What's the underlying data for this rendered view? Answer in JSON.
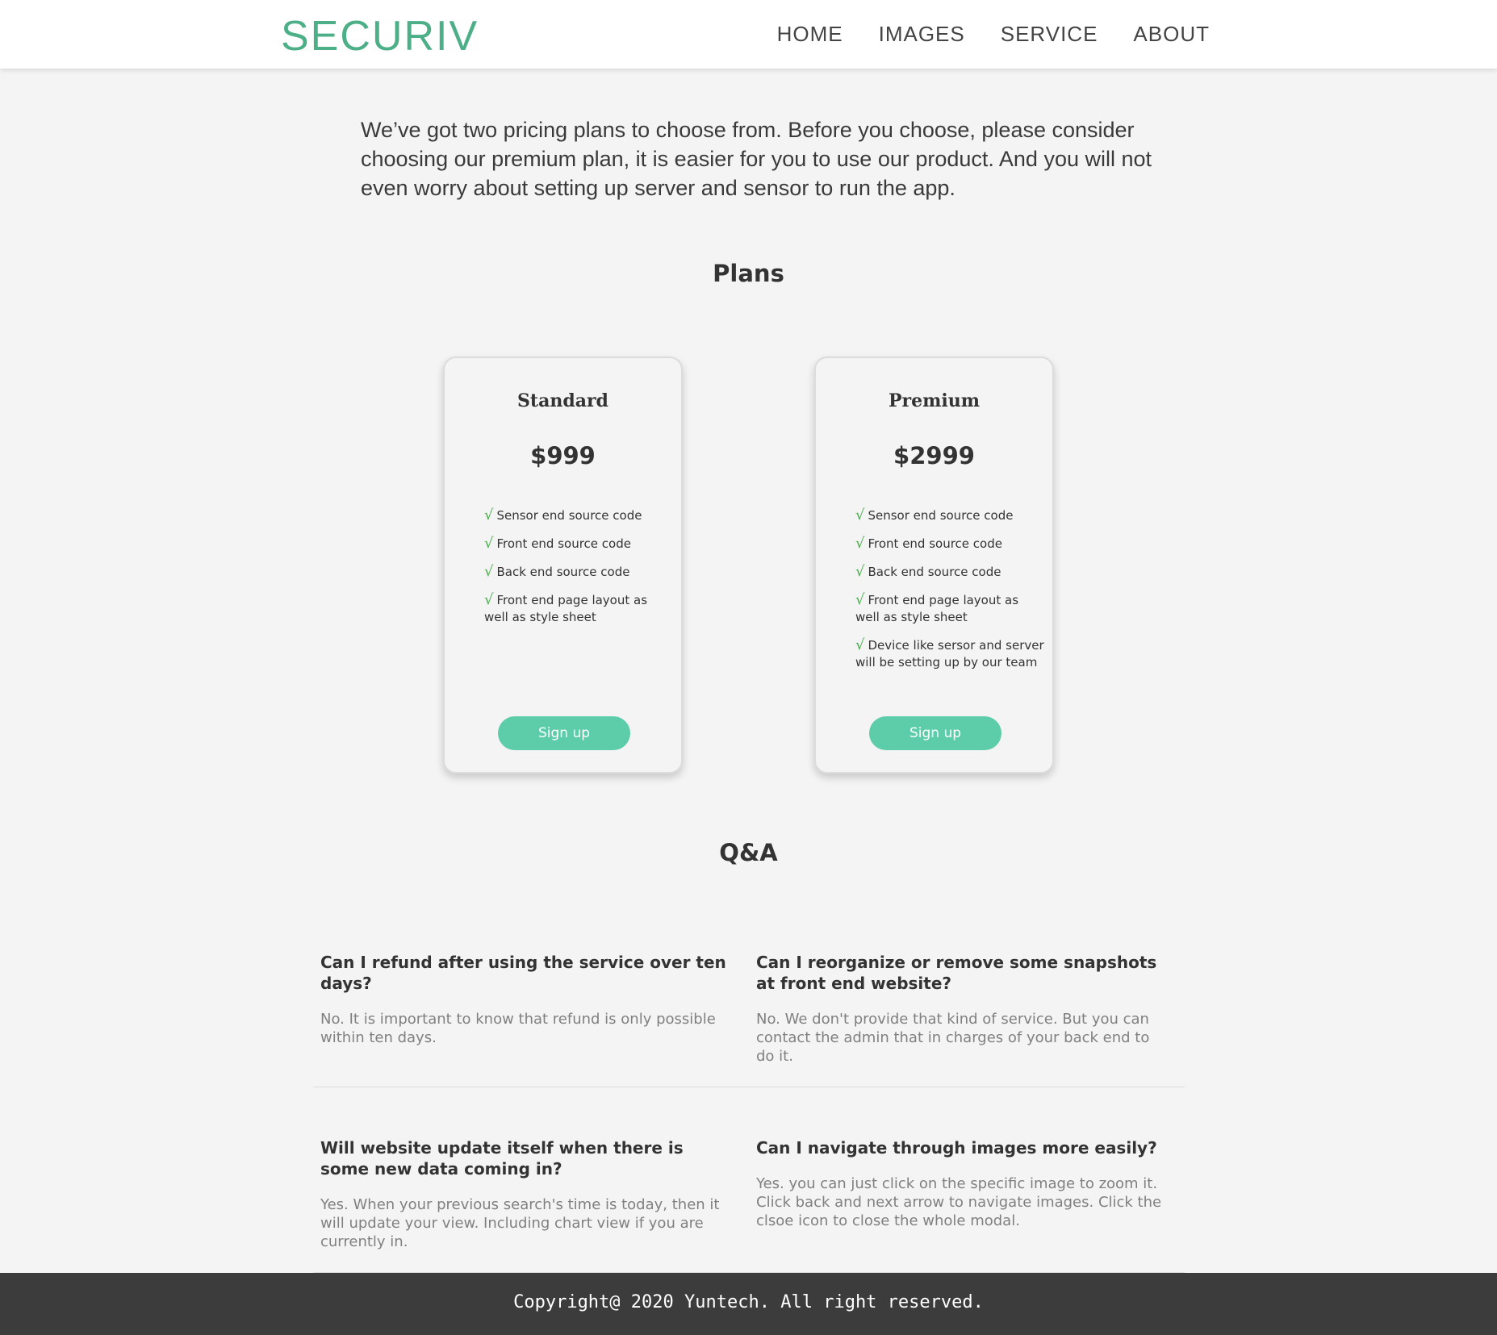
{
  "colors": {
    "brand": "#4caf88",
    "accent": "#5ccda8",
    "check": "#4caf50",
    "background": "#f4f4f4",
    "footer": "#3c3c3c"
  },
  "nav": {
    "brand": "SECURIV",
    "links": [
      "HOME",
      "IMAGES",
      "SERVICE",
      "ABOUT"
    ]
  },
  "intro": "We’ve got two pricing plans to choose from. Before you choose, please consider choosing our premium plan, it is easier for you to use our product. And you will not even worry about setting up server and sensor to run the app.",
  "plans": {
    "title": "Plans",
    "check_icon": "√",
    "items": [
      {
        "name": "Standard",
        "price": "$999",
        "features": [
          "Sensor end source code",
          "Front end source code",
          "Back end source code",
          "Front end page layout as well as style sheet"
        ],
        "button": "Sign up"
      },
      {
        "name": "Premium",
        "price": "$2999",
        "features": [
          "Sensor end source code",
          "Front end source code",
          "Back end source code",
          "Front end page layout as well as style sheet",
          "Device like sersor and server will be setting up by our team"
        ],
        "button": "Sign up"
      }
    ]
  },
  "qa": {
    "title": "Q&A",
    "items": [
      {
        "q": "Can I refund after using the service over ten days?",
        "a": "No. It is important to know that refund is only possible within ten days."
      },
      {
        "q": "Can I reorganize or remove some snapshots at front end website?",
        "a": "No. We don't provide that kind of service. But you can contact the admin that in charges of your back end to do it."
      },
      {
        "q": "Will website update itself when there is some new data coming in?",
        "a": "Yes. When your previous search's time is today, then it will update your view. Including chart view if you are currently in."
      },
      {
        "q": "Can I navigate through images more easily?",
        "a": "Yes. you can just click on the specific image to zoom it. Click back and next arrow to navigate images. Click the clsoe icon to close the whole modal."
      }
    ]
  },
  "footer": "Copyright@ 2020 Yuntech. All right reserved."
}
